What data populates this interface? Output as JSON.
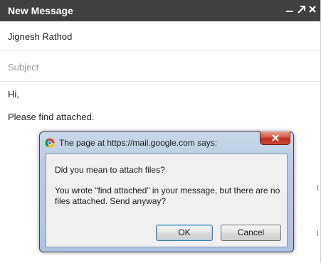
{
  "compose": {
    "title": "New Message",
    "to_value": "Jignesh Rathod",
    "subject_placeholder": "Subject",
    "body_lines": [
      "Hi,",
      "Please find attached."
    ]
  },
  "dialog": {
    "title": "The page at https://mail.google.com says:",
    "question": "Did you mean to attach files?",
    "message": "You wrote \"find attached\" in your message, but there are no files attached.  Send anyway?",
    "ok_label": "OK",
    "cancel_label": "Cancel"
  },
  "colors": {
    "header_bg": "#404040",
    "dialog_frame": "#b8cbe2",
    "close_button": "#c84a35"
  },
  "icons": {
    "minimize": "minimize-icon",
    "popout": "popout-icon",
    "close": "close-icon",
    "browser": "chrome-icon",
    "dialog_close": "close-icon"
  }
}
